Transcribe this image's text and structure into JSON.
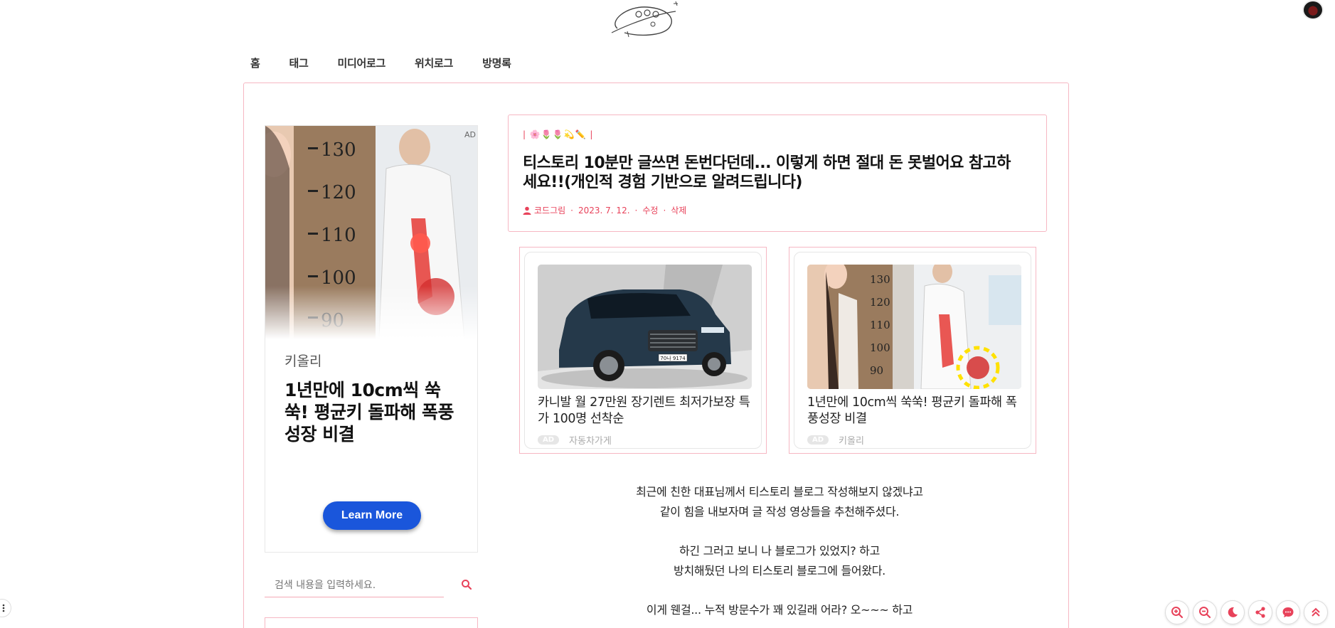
{
  "nav": {
    "items": [
      "홈",
      "태그",
      "미디어로그",
      "위치로그",
      "방명록"
    ]
  },
  "sidebar_ad": {
    "ad_tag": "AD",
    "brand": "키올리",
    "headline": "1년만에 10cm씩 쑥쑥! 평균키 돌파해 폭풍성장 비결",
    "button_label": "Learn More",
    "height_marks": [
      "130",
      "120",
      "110",
      "100",
      "90"
    ]
  },
  "search": {
    "placeholder": "검색 내용을 입력하세요."
  },
  "post": {
    "category": "| 🌸🌷🌷💫✏️ |",
    "title": "티스토리 10분만 글쓰면 돈번다던데... 이렇게 하면 절대 돈 못벌어요 참고하세요!!(개인적 경험 기반으로 알려드립니다)",
    "author": "코드그림",
    "date": "2023. 7. 12.",
    "edit_label": "수정",
    "delete_label": "삭제"
  },
  "related_ads": [
    {
      "title": "카니발 월 27만원 장기렌트 최저가보장 특가 100명 선착순",
      "ad_label": "AD",
      "advertiser": "자동차가게",
      "plate": "70나 9174"
    },
    {
      "title": "1년만에 10cm씩 쑥쑥! 평균키 돌파해 폭풍성장 비결",
      "ad_label": "AD",
      "advertiser": "키올리",
      "height_marks": [
        "130",
        "120",
        "110",
        "100",
        "90"
      ]
    }
  ],
  "body": {
    "paragraphs": [
      [
        "최근에 친한 대표님께서 티스토리 블로그 작성해보지 않겠냐고",
        "같이 힘을 내보자며 글 작성 영상들을 추천해주셨다."
      ],
      [
        "하긴 그러고 보니 나 블로그가 있었지? 하고",
        "방치해뒀던 나의 티스토리 블로그에 들어왔다."
      ],
      [
        "이게 웬걸... 누적 방문수가 꽤 있길래 어라? 오~~~ 하고"
      ]
    ]
  },
  "tools": [
    "zoom-in-icon",
    "zoom-out-icon",
    "dark-mode-icon",
    "share-icon",
    "comment-icon",
    "scroll-top-icon"
  ],
  "colors": {
    "accent": "#e8425a",
    "frame_border": "#f6b7c3",
    "button_blue": "#1a56db"
  }
}
